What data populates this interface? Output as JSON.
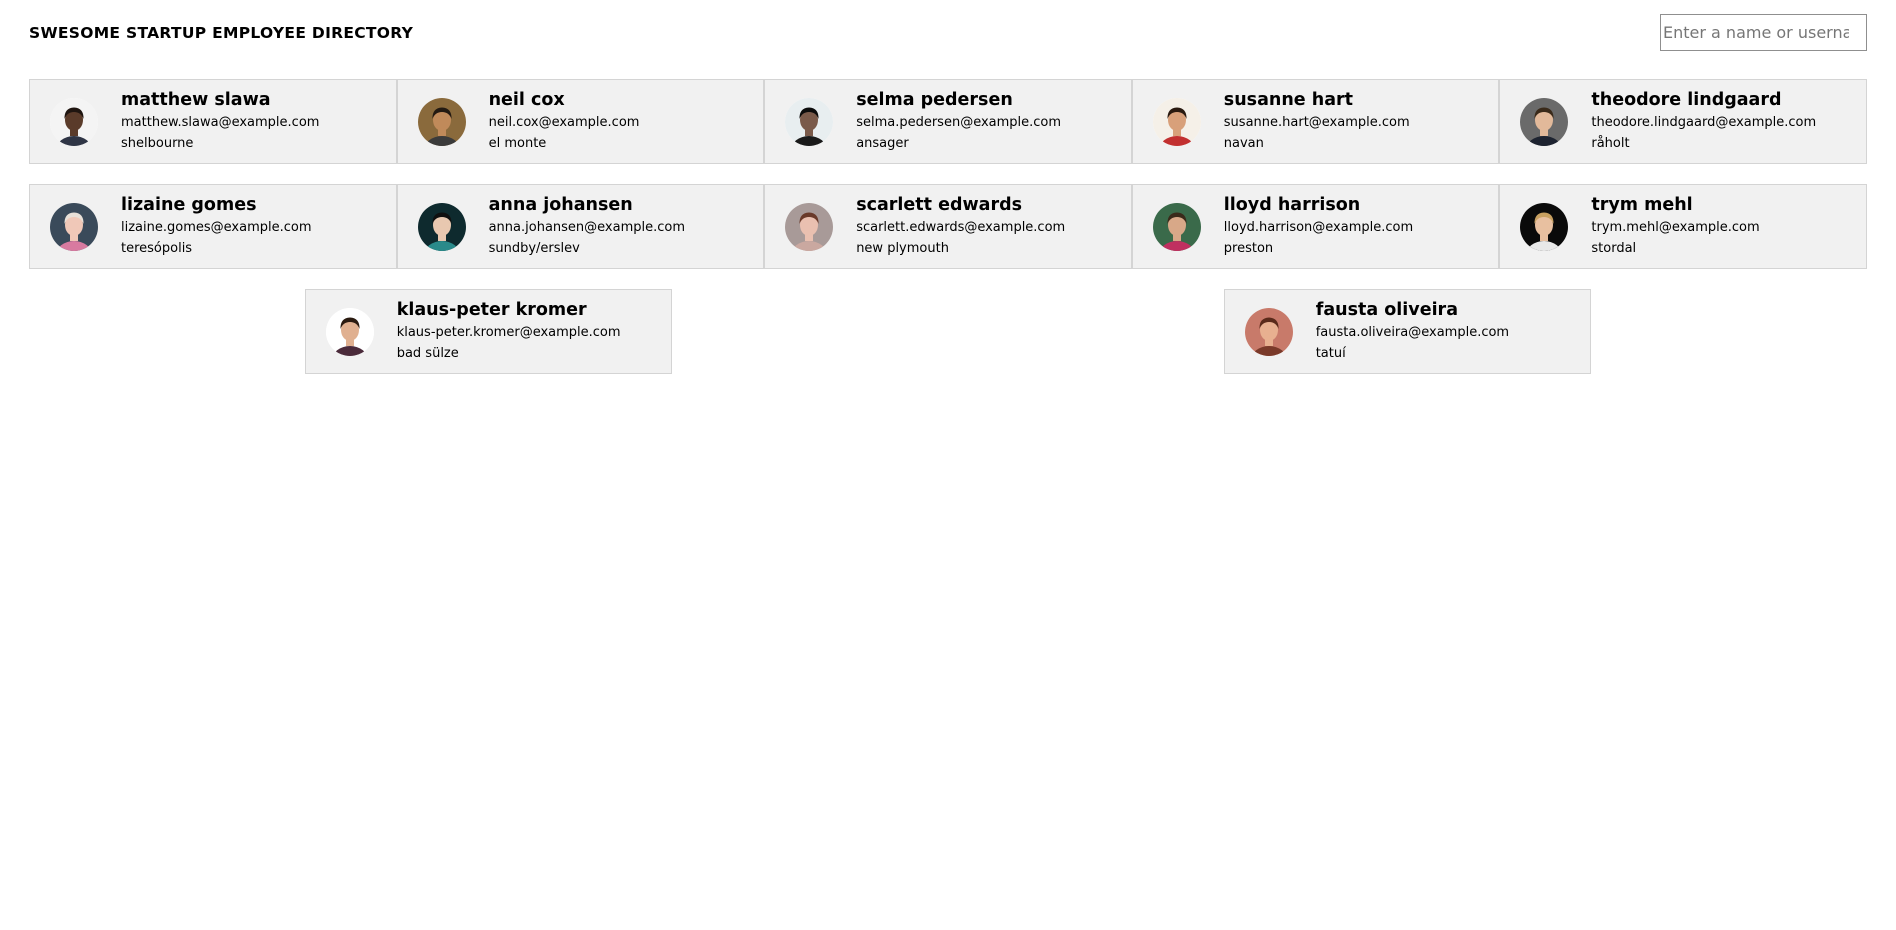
{
  "header": {
    "title": "SWESOME STARTUP EMPLOYEE DIRECTORY",
    "search_placeholder": "Enter a name or username"
  },
  "employees": [
    {
      "name": "matthew slawa",
      "email": "matthew.slawa@example.com",
      "city": "shelbourne",
      "avatar": {
        "bg": "#f4f4f4",
        "hair": "#1f1510",
        "skin": "#5a3b2a",
        "shirt": "#2f3545",
        "icon": "person-avatar-icon"
      }
    },
    {
      "name": "neil cox",
      "email": "neil.cox@example.com",
      "city": "el monte",
      "avatar": {
        "bg": "#8a6a3c",
        "hair": "#231a12",
        "skin": "#c08a5a",
        "shirt": "#3b3b3b",
        "icon": "person-avatar-icon"
      }
    },
    {
      "name": "selma pedersen",
      "email": "selma.pedersen@example.com",
      "city": "ansager",
      "avatar": {
        "bg": "#e8eef0",
        "hair": "#0c0c0c",
        "skin": "#7a5a4a",
        "shirt": "#1a1a1a",
        "icon": "person-avatar-icon"
      }
    },
    {
      "name": "susanne hart",
      "email": "susanne.hart@example.com",
      "city": "navan",
      "avatar": {
        "bg": "#f5f0e8",
        "hair": "#2a1a10",
        "skin": "#d8a07a",
        "shirt": "#c23030",
        "icon": "person-avatar-icon"
      }
    },
    {
      "name": "theodore lindgaard",
      "email": "theodore.lindgaard@example.com",
      "city": "råholt",
      "avatar": {
        "bg": "#6a6a6a",
        "hair": "#3a2a1a",
        "skin": "#e2b99a",
        "shirt": "#1d2330",
        "icon": "person-avatar-icon"
      }
    },
    {
      "name": "lizaine gomes",
      "email": "lizaine.gomes@example.com",
      "city": "teresópolis",
      "avatar": {
        "bg": "#3a4a5a",
        "hair": "#e8e0d8",
        "skin": "#f0c8b8",
        "shirt": "#d87aa0",
        "icon": "person-avatar-icon"
      }
    },
    {
      "name": "anna johansen",
      "email": "anna.johansen@example.com",
      "city": "sundby/erslev",
      "avatar": {
        "bg": "#0e2a2e",
        "hair": "#101010",
        "skin": "#e8c8b0",
        "shirt": "#2a8a8a",
        "icon": "person-avatar-icon"
      }
    },
    {
      "name": "scarlett edwards",
      "email": "scarlett.edwards@example.com",
      "city": "new plymouth",
      "avatar": {
        "bg": "#a89a98",
        "hair": "#6a3a2a",
        "skin": "#eac0b0",
        "shirt": "#caa8a0",
        "icon": "person-avatar-icon"
      }
    },
    {
      "name": "lloyd harrison",
      "email": "lloyd.harrison@example.com",
      "city": "preston",
      "avatar": {
        "bg": "#3a6a4a",
        "hair": "#3a2a1a",
        "skin": "#d8a888",
        "shirt": "#c03060",
        "icon": "person-avatar-icon"
      }
    },
    {
      "name": "trym mehl",
      "email": "trym.mehl@example.com",
      "city": "stordal",
      "avatar": {
        "bg": "#0a0a0a",
        "hair": "#c8a060",
        "skin": "#e8c0a0",
        "shirt": "#e8e8e8",
        "icon": "person-avatar-icon"
      }
    },
    {
      "name": "klaus-peter kromer",
      "email": "klaus-peter.kromer@example.com",
      "city": "bad sülze",
      "avatar": {
        "bg": "#ffffff",
        "hair": "#2a1a10",
        "skin": "#e0b090",
        "shirt": "#4a2a3a",
        "icon": "person-avatar-icon"
      }
    },
    {
      "name": "fausta oliveira",
      "email": "fausta.oliveira@example.com",
      "city": "tatuí",
      "avatar": {
        "bg": "#c87a6a",
        "hair": "#5a2a1a",
        "skin": "#e8b090",
        "shirt": "#7a3a2a",
        "icon": "person-avatar-icon"
      }
    }
  ]
}
